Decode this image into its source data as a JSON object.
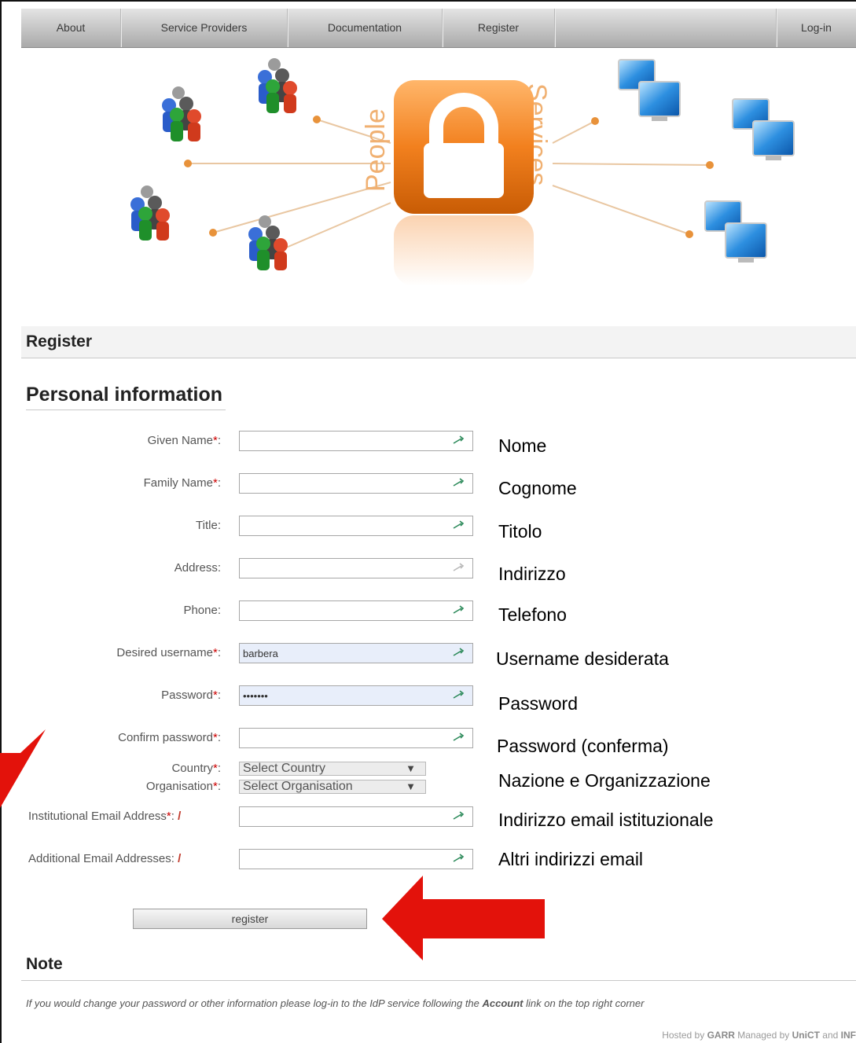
{
  "nav": {
    "about": "About",
    "service_providers": "Service Providers",
    "documentation": "Documentation",
    "register": "Register",
    "login": "Log-in"
  },
  "banner": {
    "left_word": "People",
    "right_word": "Services",
    "icons": [
      "people-group-icon",
      "padlock-icon",
      "computer-monitors-icon"
    ]
  },
  "page": {
    "register_title": "Register",
    "section_title": "Personal information"
  },
  "form": {
    "given_name_label": "Given Name",
    "family_name_label": "Family Name",
    "title_label": "Title:",
    "address_label": "Address:",
    "phone_label": "Phone:",
    "username_label": "Desired username",
    "username_value": "barbera",
    "password_label": "Password",
    "password_value": "•••••••",
    "confirm_password_label": "Confirm password",
    "country_label": "Country",
    "country_selected": "Select Country",
    "organisation_label": "Organisation",
    "organisation_selected": "Select Organisation",
    "institutional_email_label": "Institutional Email Address",
    "additional_email_label": "Additional Email Addresses:",
    "required_mark": "*",
    "colon": ":",
    "register_button": "register"
  },
  "italian_labels": {
    "given_name": "Nome",
    "family_name": "Cognome",
    "title": "Titolo",
    "address": "Indirizzo",
    "phone": "Telefono",
    "username": "Username desiderata",
    "password": "Password",
    "confirm_password": "Password (conferma)",
    "country_org": "Nazione e Organizzazione",
    "institutional_email": "Indirizzo email istituzionale",
    "additional_email": "Altri indirizzi email"
  },
  "note": {
    "title": "Note",
    "text_before": "If you would change your password or other information please log-in to the IdP service following the ",
    "text_link": "Account",
    "text_after": " link on the top right corner"
  },
  "footer": {
    "hosted_by": "Hosted by ",
    "garr": "GARR",
    "managed_by": "  Managed by ",
    "unict": "UniCT",
    "and": " and ",
    "inf": "INF"
  },
  "colors": {
    "arrow_red": "#e3120b",
    "lock_orange": "#f2801e",
    "nav_bg": "#c4c4c4"
  }
}
